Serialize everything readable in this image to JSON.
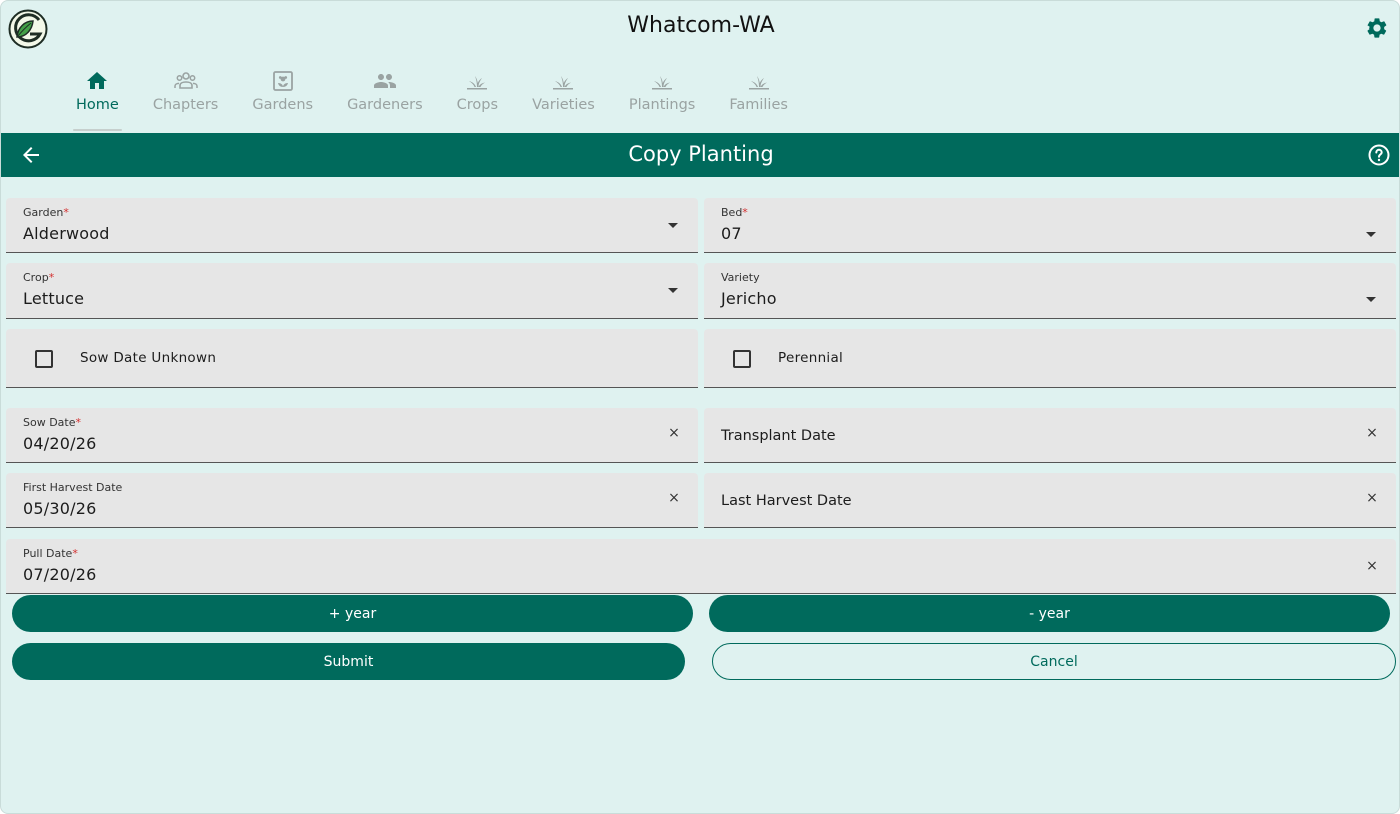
{
  "header": {
    "title": "Whatcom-WA",
    "logo_icon": "garden-logo-icon",
    "settings_icon": "gear-icon"
  },
  "nav": {
    "tabs": [
      {
        "label": "Home",
        "icon": "home-icon",
        "active": true
      },
      {
        "label": "Chapters",
        "icon": "groups-icon",
        "active": false
      },
      {
        "label": "Gardens",
        "icon": "garden-frame-icon",
        "active": false
      },
      {
        "label": "Gardeners",
        "icon": "people-icon",
        "active": false
      },
      {
        "label": "Crops",
        "icon": "sprout-icon",
        "active": false
      },
      {
        "label": "Varieties",
        "icon": "sprout-icon",
        "active": false
      },
      {
        "label": "Plantings",
        "icon": "sprout-icon",
        "active": false
      },
      {
        "label": "Families",
        "icon": "sprout-icon",
        "active": false
      }
    ]
  },
  "toolbar": {
    "title": "Copy Planting",
    "back_icon": "arrow-back-icon",
    "help_icon": "help-icon"
  },
  "form": {
    "garden": {
      "label": "Garden",
      "required_mark": "*",
      "value": "Alderwood"
    },
    "bed": {
      "label": "Bed",
      "required_mark": "*",
      "value": "07"
    },
    "crop": {
      "label": "Crop",
      "required_mark": "*",
      "value": "Lettuce"
    },
    "variety": {
      "label": "Variety",
      "value": "Jericho"
    },
    "sow_date_unknown": {
      "label": "Sow Date Unknown",
      "checked": false
    },
    "perennial": {
      "label": "Perennial",
      "checked": false
    },
    "sow_date": {
      "label": "Sow Date",
      "required_mark": "*",
      "value": "04/20/26"
    },
    "transplant_date": {
      "placeholder": "Transplant Date"
    },
    "first_harvest_date": {
      "label": "First Harvest Date",
      "value": "05/30/26"
    },
    "last_harvest_date": {
      "placeholder": "Last Harvest Date"
    },
    "pull_date": {
      "label": "Pull Date",
      "required_mark": "*",
      "value": "07/20/26"
    },
    "clear_symbol": "×"
  },
  "buttons": {
    "plus_year": "+ year",
    "minus_year": "- year",
    "submit": "Submit",
    "cancel": "Cancel"
  },
  "colors": {
    "primary": "#006a5c",
    "background": "#dff2f0",
    "field": "#e6e6e6",
    "required": "#d32f2f",
    "inactive_tab": "#9aa3a2"
  }
}
